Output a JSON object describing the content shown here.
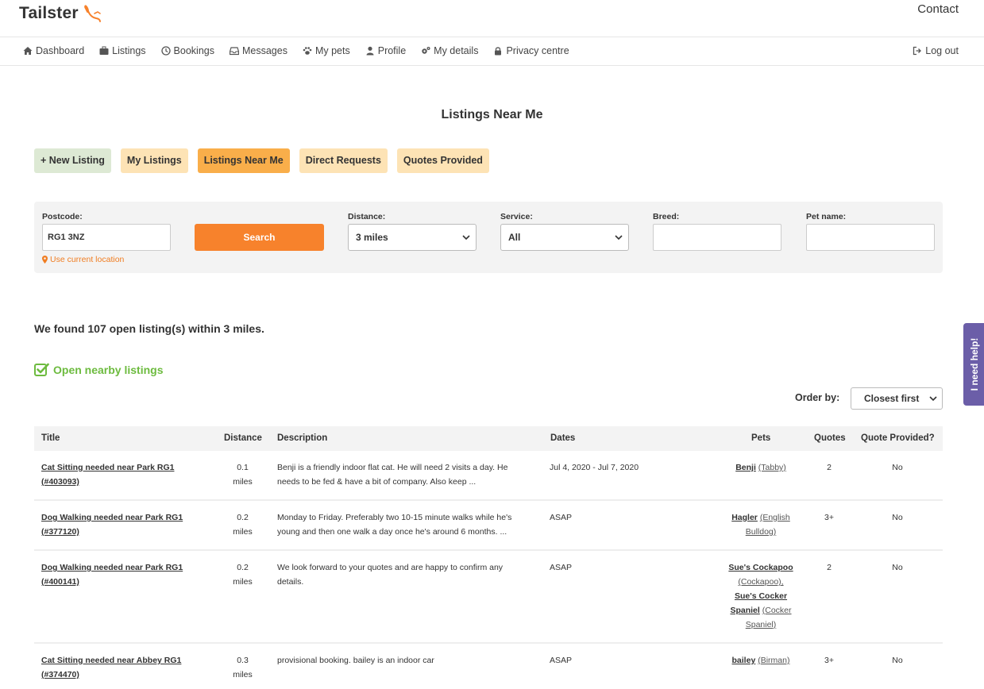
{
  "header": {
    "logo_text": "Tailster",
    "contact": "Contact"
  },
  "nav": {
    "items": [
      {
        "label": "Dashboard",
        "icon": "home-icon"
      },
      {
        "label": "Listings",
        "icon": "briefcase-icon"
      },
      {
        "label": "Bookings",
        "icon": "clock-icon"
      },
      {
        "label": "Messages",
        "icon": "inbox-icon"
      },
      {
        "label": "My pets",
        "icon": "paw-icon"
      },
      {
        "label": "Profile",
        "icon": "user-icon"
      },
      {
        "label": "My details",
        "icon": "gears-icon"
      },
      {
        "label": "Privacy centre",
        "icon": "lock-icon"
      }
    ],
    "logout": "Log out"
  },
  "page_title": "Listings Near Me",
  "tabs": {
    "new_listing": "+ New Listing",
    "my_listings": "My Listings",
    "listings_near_me": "Listings Near Me",
    "direct_requests": "Direct Requests",
    "quotes_provided": "Quotes Provided"
  },
  "search": {
    "postcode_label": "Postcode:",
    "postcode_value": "RG1 3NZ",
    "search_button": "Search",
    "use_location": "Use current location",
    "distance_label": "Distance:",
    "distance_value": "3 miles",
    "service_label": "Service:",
    "service_value": "All",
    "breed_label": "Breed:",
    "breed_value": "",
    "petname_label": "Pet name:",
    "petname_value": ""
  },
  "results": {
    "found_text": "We found 107 open listing(s) within 3 miles.",
    "open_nearby": "Open nearby listings",
    "order_label": "Order by:",
    "order_value": "Closest first"
  },
  "table": {
    "headers": {
      "title": "Title",
      "distance": "Distance",
      "description": "Description",
      "dates": "Dates",
      "pets": "Pets",
      "quotes": "Quotes",
      "quote_provided": "Quote Provided?"
    },
    "rows": [
      {
        "title_line1": "Cat Sitting needed near Park RG1",
        "title_line2": "(#403093)",
        "distance_val": "0.1",
        "distance_unit": "miles",
        "desc_line1": "Benji is a friendly indoor flat cat. He will need 2 visits a day. He",
        "desc_line2": "needs to be fed & have a bit of company. Also keep ...",
        "dates": "Jul 4, 2020 - Jul 7, 2020",
        "pets_lines": [
          {
            "name": "Benji",
            "breed": "(Tabby)"
          }
        ],
        "quotes": "2",
        "quote_provided": "No"
      },
      {
        "title_line1": "Dog Walking needed near Park RG1",
        "title_line2": "(#377120)",
        "distance_val": "0.2",
        "distance_unit": "miles",
        "desc_line1": "Monday to Friday. Preferably two 10-15 minute walks while he's",
        "desc_line2": "young and then one walk a day once he's around 6 months. ...",
        "dates": "ASAP",
        "pets_lines": [
          {
            "name": "Hagler",
            "breed": "(English"
          },
          {
            "name": "",
            "breed": "Bulldog)"
          }
        ],
        "quotes": "3+",
        "quote_provided": "No"
      },
      {
        "title_line1": "Dog Walking needed near Park RG1",
        "title_line2": "(#400141)",
        "distance_val": "0.2",
        "distance_unit": "miles",
        "desc_line1": "We look forward to your quotes and are happy to confirm any",
        "desc_line2": "details.",
        "dates": "ASAP",
        "pets_lines": [
          {
            "name": "Sue's Cockapoo",
            "breed": ""
          },
          {
            "name": "",
            "breed": "(Cockapoo),"
          },
          {
            "name": "Sue's Cocker",
            "breed": ""
          },
          {
            "name": "Spaniel",
            "breed": "(Cocker"
          },
          {
            "name": "",
            "breed": "Spaniel)"
          }
        ],
        "quotes": "2",
        "quote_provided": "No"
      },
      {
        "title_line1": "Cat Sitting needed near Abbey RG1",
        "title_line2": "(#374470)",
        "distance_val": "0.3",
        "distance_unit": "miles",
        "desc_line1": "provisional booking. bailey is an indoor car",
        "desc_line2": "",
        "dates": "ASAP",
        "pets_lines": [
          {
            "name": "bailey",
            "breed": "(Birman)"
          }
        ],
        "quotes": "3+",
        "quote_provided": "No"
      }
    ]
  },
  "help_tab": "I need help!",
  "colors": {
    "accent_orange": "#f7822c",
    "active_tab": "#f9ae4a",
    "light_tab": "#fde3b5",
    "new_tab": "#dde9d4",
    "green": "#6dbb3f",
    "help_purple": "#6b5ea8"
  }
}
